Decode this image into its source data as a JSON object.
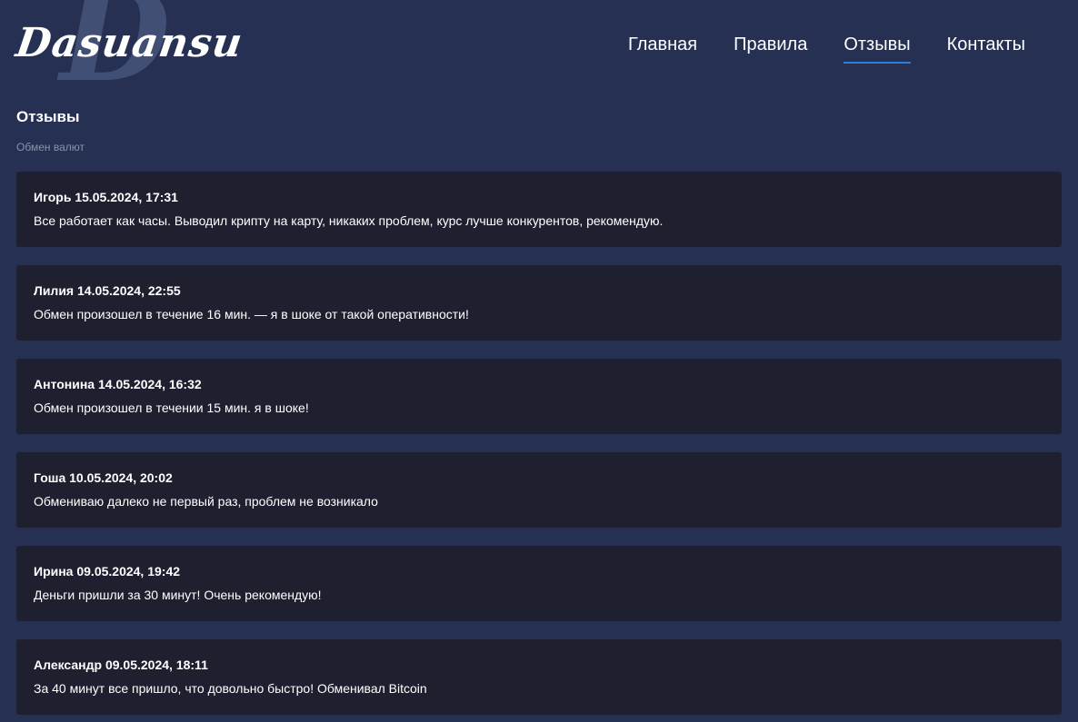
{
  "header": {
    "logo_text": "Dasuansu",
    "logo_letter": "D",
    "nav": [
      {
        "label": "Главная",
        "active": false
      },
      {
        "label": "Правила",
        "active": false
      },
      {
        "label": "Отзывы",
        "active": true
      },
      {
        "label": "Контакты",
        "active": false
      }
    ]
  },
  "page": {
    "title": "Отзывы",
    "breadcrumb": "Обмен валют"
  },
  "reviews": [
    {
      "name": "Игорь",
      "date": "15.05.2024, 17:31",
      "text": "Все работает как часы. Выводил крипту на карту, никаких проблем, курс лучше конкурентов, рекомендую."
    },
    {
      "name": "Лилия",
      "date": "14.05.2024, 22:55",
      "text": "Обмен произошел в течение 16 мин. — я в шоке от такой оперативности!"
    },
    {
      "name": "Антонина",
      "date": "14.05.2024, 16:32",
      "text": "Обмен произошел в течении 15 мин. я в шоке!"
    },
    {
      "name": "Гоша",
      "date": "10.05.2024, 20:02",
      "text": "Обмениваю далеко не первый раз, проблем не возникало"
    },
    {
      "name": "Ирина",
      "date": "09.05.2024, 19:42",
      "text": "Деньги пришли за 30 минут! Очень рекомендую!"
    },
    {
      "name": "Александр",
      "date": "09.05.2024, 18:11",
      "text": "За 40 минут все пришло, что довольно быстро! Обменивал Bitcoin"
    }
  ],
  "colors": {
    "background": "#253053",
    "card": "#1e2030",
    "nav_active_underline": "#2f7ed8",
    "breadcrumb": "#8a93ad"
  }
}
